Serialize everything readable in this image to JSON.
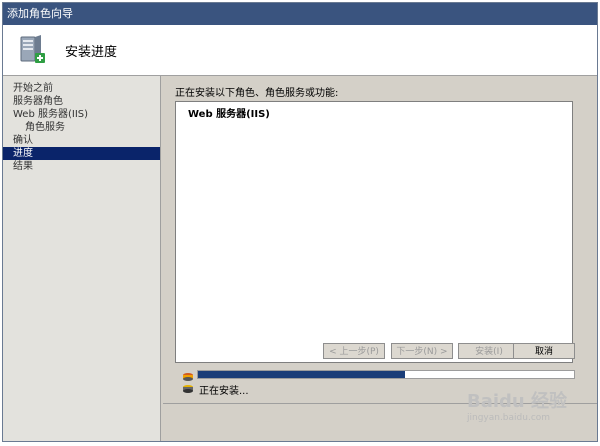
{
  "window": {
    "title": "添加角色向导"
  },
  "header": {
    "title": "安装进度",
    "icon": "server-add-icon"
  },
  "nav": {
    "items": [
      {
        "label": "开始之前",
        "indent": false,
        "active": false
      },
      {
        "label": "服务器角色",
        "indent": false,
        "active": false
      },
      {
        "label": "Web 服务器(IIS)",
        "indent": false,
        "active": false
      },
      {
        "label": "角色服务",
        "indent": true,
        "active": false
      },
      {
        "label": "确认",
        "indent": false,
        "active": false
      },
      {
        "label": "进度",
        "indent": false,
        "active": true
      },
      {
        "label": "结果",
        "indent": false,
        "active": false
      }
    ]
  },
  "main": {
    "list_label": "正在安装以下角色、角色服务或功能:",
    "items": [
      "Web 服务器(IIS)"
    ],
    "progress": {
      "value": 0.55,
      "status": "正在安装..."
    }
  },
  "buttons": {
    "prev": "< 上一步(P)",
    "next": "下一步(N) >",
    "install": "安装(I)",
    "cancel": "取消"
  },
  "watermark": {
    "brand": "Baidu 经验",
    "url": "jingyan.baidu.com"
  }
}
